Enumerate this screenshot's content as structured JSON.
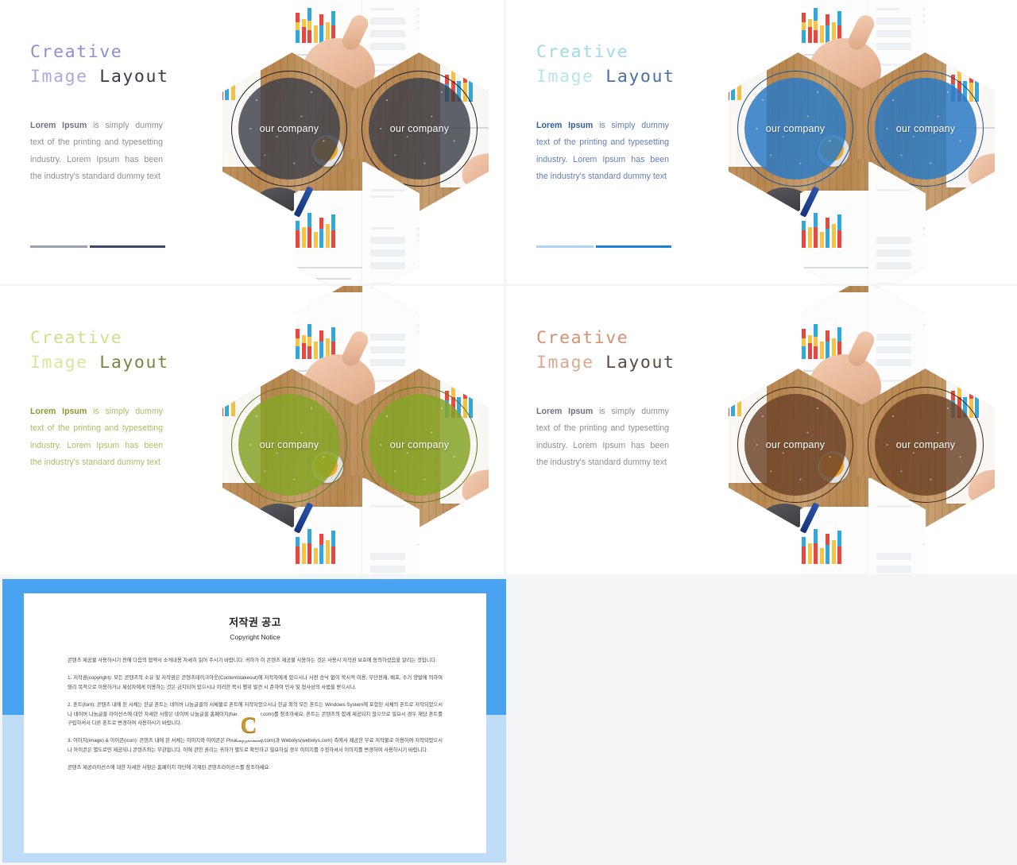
{
  "slides": [
    {
      "id": "slide-1",
      "title_accent": "Creative",
      "title_accent2": "Image",
      "title_dark": "Layout",
      "accent_color": "#8e8fd0",
      "accent_color_2": "#a9aadd",
      "lead": "Lorem Ipsum",
      "body": " is simply dummy text of the printing and typesetting industry. Lorem Ipsum has been the industry's standard dummy text",
      "body_color": "#8e8e96",
      "divider_left": "#9aa0b4",
      "divider_right": "#3f4764",
      "badge_label": "our company",
      "overlay_color": "#3d3f49",
      "overlay_opacity": "0.82",
      "ring_color": "#1b1d26"
    },
    {
      "id": "slide-2",
      "title_accent": "Creative",
      "title_accent2": "Image",
      "title_dark": "Layout",
      "accent_color": "#9ddbe8",
      "accent_color_2": "#5f7fb8",
      "lead": "Lorem Ipsum",
      "body": " is simply dummy text of the printing and typesetting industry. Lorem Ipsum has been the industry's standard dummy text",
      "body_color": "#5f7fb8",
      "divider_left": "#aed2f4",
      "divider_right": "#1a81d6",
      "badge_label": "our company",
      "overlay_color": "#2b7ac4",
      "overlay_opacity": "0.85",
      "ring_color": "#17508f"
    },
    {
      "id": "slide-3",
      "title_accent": "Creative",
      "title_accent2": "Image",
      "title_dark": "Layout",
      "accent_color": "#d4dd8a",
      "accent_color_2": "#8b9440",
      "lead": "Lorem Ipsum",
      "body": " is simply dummy text of the printing and typesetting industry. Lorem Ipsum has been the industry's standard dummy text",
      "body_color": "#b2bb63",
      "divider_left": "#ddee55",
      "divider_right": "#8f9a2c",
      "badge_label": "our company",
      "overlay_color": "#86a428",
      "overlay_opacity": "0.86",
      "ring_color": "#5d7a14"
    },
    {
      "id": "slide-4",
      "title_accent": "#d59070",
      "title_accent_text": "Creative",
      "title_accent2": "Image",
      "title_dark": "Layout",
      "accent_color": "#d59070",
      "accent_color_2": "#6b5a52",
      "lead": "Lorem Ipsum",
      "body": " is simply dummy text of the printing and typesetting industry. Lorem Ipsum has been the industry's standard dummy text",
      "body_color": "#8e8e96",
      "divider_left": "#d0702a",
      "divider_right": "#4a2a14",
      "badge_label": "our company",
      "overlay_color": "#6d4428",
      "overlay_opacity": "0.84",
      "ring_color": "#43280f"
    }
  ],
  "notice": {
    "title": "저작권 공고",
    "subtitle": "Copyright Notice",
    "paragraphs": [
      "콘텐츠 제공물 사용하시기 전에 다음의 협약서 소개내용 자세히 읽어 주시기 바랍니다. 귀하가 이 콘텐츠 제공물 사용하는 것은 사용시 저작권 보호에 동의하셨음을 알리는 것입니다.",
      "1. 저작권(copyright): 모든 콘텐츠의 소유 및 저작권은 콘텐츠테이크아웃(Contentstakeout)에 저작자에게 있으시나 사전 승낙 없이 묵시적 이용, 무단전재, 배포, 수기 양발에 의하여 영리 목적으로 이용하거나 제삼자에게 이용하는 것은 금지되어 있으시나 이러한 묵시 행위 발견 시 준하여 민사 및 형사상의 사법을 받으시나.",
      "2. 폰트(font): 콘텐츠 내에 된 서체는 한글 폰트는 네이버 나눔글꼴의 서체물로 폰트에 저작되었으시나 한글 외의 모든 폰트는 Windows System에 포함된 서체의 폰트로 저작되었으시나 네이버 나눔글꼴 라이선스에 대한 자세한 사항은 네이버 나눔글꼴 홈페이지(hangeul.naver.com)를 참조하세요. 폰트는 콘텐츠의 함께 제공되지 않으므로 필요시 경우 해당 폰트를 구입하셔서 다른 폰트로 변경하여 사용하시기 바랍니다.",
      "3. 이미지(image) & 아이콘(icon): 콘텐츠 내에 된 서체는 이미지와 아이콘은 Pixabay(pixabay.com)과 Webolys(webolys.com) 측에서 제공한 무료 저작물로 이용하여 저작되었으시나 아이콘은 별도로만 제공되니 콘텐츠와는 무관합니다. 이에 관한 권리는 귀하가 별도로 확인하고 필요하실 경우 이미지를 수정하셔서 이미지를 변경하여 사용하시기 바랍니다.",
      "콘텐츠 제공라이선스에 대한 자세한 사항은 홈페이지 하단에 기재된 콘텐츠라이선스를 참조하세요."
    ],
    "watermark": "C"
  }
}
